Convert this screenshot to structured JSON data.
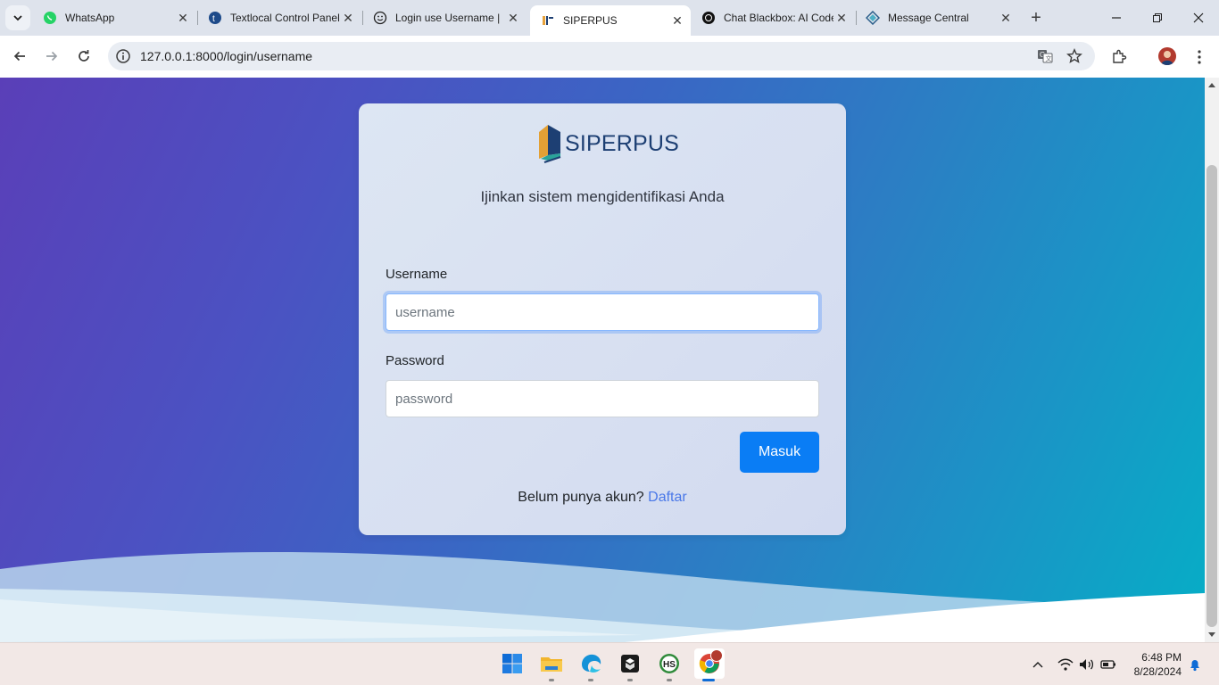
{
  "browser": {
    "tabs": [
      {
        "title": "WhatsApp",
        "icon": "whatsapp-icon"
      },
      {
        "title": "Textlocal Control Panel",
        "icon": "textlocal-icon"
      },
      {
        "title": "Login use Username | ",
        "icon": "smiley-icon"
      },
      {
        "title": "SIPERPUS",
        "icon": "siperpus-icon",
        "active": true
      },
      {
        "title": "Chat Blackbox: AI Code",
        "icon": "blackbox-icon"
      },
      {
        "title": "Message Central",
        "icon": "message-central-icon"
      }
    ],
    "url": "127.0.0.1:8000/login/username"
  },
  "page": {
    "logo_text": "SIPERPUS",
    "subtitle": "Ijinkan sistem mengidentifikasi Anda",
    "username_label": "Username",
    "username_placeholder": "username",
    "password_label": "Password",
    "password_placeholder": "password",
    "submit_label": "Masuk",
    "signup_text": "Belum punya akun?",
    "signup_link": "Daftar"
  },
  "taskbar": {
    "time": "6:48 PM",
    "date": "8/28/2024"
  },
  "colors": {
    "gradient_start": "#5a3fb8",
    "gradient_end": "#06aec6",
    "button": "#0a7df5",
    "link": "#4a78e8"
  }
}
